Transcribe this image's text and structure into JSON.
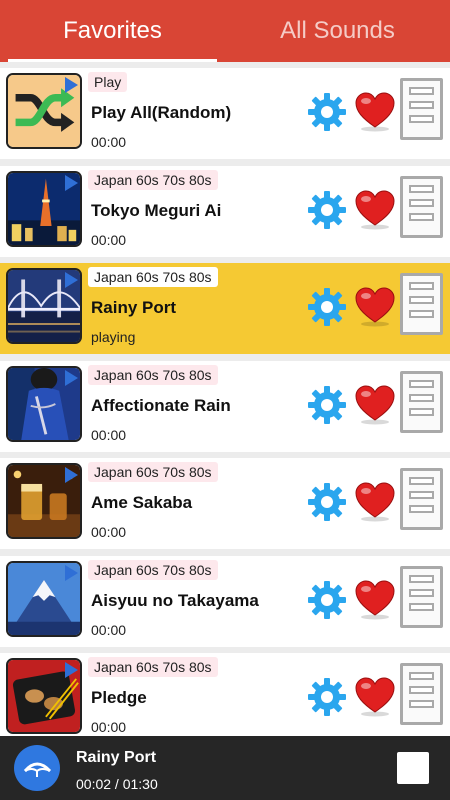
{
  "tabs": [
    {
      "label": "Favorites",
      "active": true
    },
    {
      "label": "All Sounds",
      "active": false
    }
  ],
  "items": [
    {
      "tag": "Play",
      "title": "Play All(Random)",
      "status": "00:00",
      "thumb": "shuffle-icon",
      "playing": false
    },
    {
      "tag": "Japan 60s 70s 80s",
      "title": "Tokyo Meguri Ai",
      "status": "00:00",
      "thumb": "tokyo-tower-night",
      "playing": false
    },
    {
      "tag": "Japan 60s 70s 80s",
      "title": "Rainy Port",
      "status": "playing",
      "thumb": "bridge-night",
      "playing": true
    },
    {
      "tag": "Japan 60s 70s 80s",
      "title": "Affectionate Rain",
      "status": "00:00",
      "thumb": "person-in-blue",
      "playing": false
    },
    {
      "tag": "Japan 60s 70s 80s",
      "title": "Ame Sakaba",
      "status": "00:00",
      "thumb": "bar-glasses",
      "playing": false
    },
    {
      "tag": "Japan 60s 70s 80s",
      "title": "Aisyuu no Takayama",
      "status": "00:00",
      "thumb": "mount-fuji",
      "playing": false
    },
    {
      "tag": "Japan 60s 70s 80s",
      "title": "Pledge",
      "status": "00:00",
      "thumb": "food-tray",
      "playing": false
    }
  ],
  "player": {
    "title": "Rainy Port",
    "time": "00:02 / 01:30"
  },
  "colors": {
    "tabbar": "#d94535",
    "highlight": "#f5c933",
    "gear": "#2aa6ee",
    "heart": "#e02020",
    "player_bg": "#262626",
    "disc": "#2f78e0"
  }
}
